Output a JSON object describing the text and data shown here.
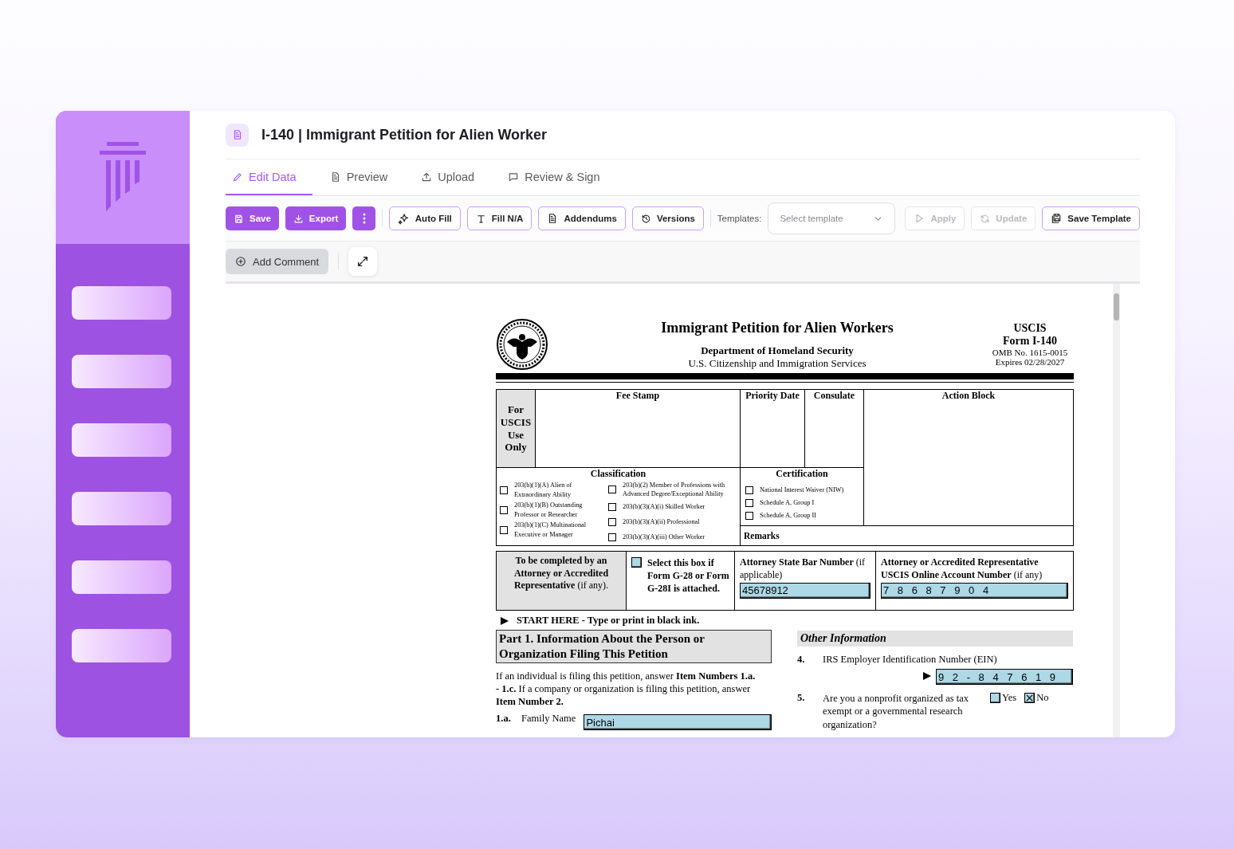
{
  "sidebar": {
    "items": [
      {
        "kind": "placeholder"
      },
      {
        "kind": "placeholder"
      },
      {
        "kind": "placeholder"
      },
      {
        "kind": "placeholder"
      },
      {
        "kind": "placeholder"
      },
      {
        "kind": "placeholder"
      }
    ]
  },
  "header": {
    "title": "I-140 | Immigrant Petition for Alien Worker"
  },
  "tabs": [
    {
      "label": "Edit Data",
      "selected": true
    },
    {
      "label": "Preview",
      "selected": false
    },
    {
      "label": "Upload",
      "selected": false
    },
    {
      "label": "Review & Sign",
      "selected": false
    }
  ],
  "toolbar": {
    "buttons": [
      {
        "kind": "primary",
        "label": "Save"
      },
      {
        "kind": "primary",
        "label": "Export"
      },
      {
        "kind": "menu"
      },
      {
        "kind": "outline",
        "label": "Auto Fill"
      },
      {
        "kind": "outline",
        "label": "Fill N/A"
      },
      {
        "kind": "outline",
        "label": "Addendums"
      },
      {
        "kind": "outline",
        "label": "Versions"
      }
    ],
    "templates_label": "Templates:",
    "template_select": {
      "placeholder": "Select template"
    },
    "template_buttons": [
      {
        "label": "Apply",
        "disabled": true
      },
      {
        "label": "Update",
        "disabled": true
      },
      {
        "label": "Save Template",
        "disabled": false
      }
    ]
  },
  "comment_bar": {
    "add_comment": "Add Comment"
  },
  "form": {
    "title": "Immigrant Petition for Alien Workers",
    "department": "Department of Homeland Security",
    "agency": "U.S. Citizenship and Immigration Services",
    "agency_short": "USCIS",
    "form_number": "Form I-140",
    "omb": "OMB No. 1615-0015",
    "expires": "Expires 02/28/2027",
    "office_block": {
      "use_only": "For USCIS Use Only",
      "fee_stamp": "Fee Stamp",
      "priority_date": "Priority Date",
      "consulate": "Consulate",
      "action_block": "Action Block",
      "remarks": "Remarks",
      "classification": {
        "title": "Classification",
        "columns": [
          {
            "items": [
              {
                "label": "203(b)(1)(A) Alien of Extraordinary Ability",
                "checked": false
              },
              {
                "label": "203(b)(1)(B) Outstanding Professor or Researcher",
                "checked": false
              },
              {
                "label": "203(b)(1)(C) Multinational Executive or Manager",
                "checked": false
              }
            ]
          },
          {
            "items": [
              {
                "label": "203(b)(2) Member of Professions with Advanced Degree/Exceptional Ability",
                "checked": false
              },
              {
                "label": "203(b)(3)(A)(i) Skilled Worker",
                "checked": false
              },
              {
                "label": "203(b)(3)(A)(ii) Professional",
                "checked": false
              },
              {
                "label": "203(b)(3)(A)(iii) Other Worker",
                "checked": false
              }
            ]
          }
        ]
      },
      "certification": {
        "title": "Certification",
        "items": [
          {
            "label": "National Interest Waiver (NIW)",
            "checked": false
          },
          {
            "label": "Schedule A, Group I",
            "checked": false
          },
          {
            "label": "Schedule A, Group II",
            "checked": false
          }
        ]
      }
    },
    "attorney_block": {
      "note": "**To be completed by an Attorney or Accredited Representative** (if any).",
      "g28": {
        "label": "Select this box if Form G-28 or Form G-28I is attached.",
        "checked": false
      },
      "bar_number": {
        "label": "**Attorney State Bar Number** (if applicable)",
        "value": "45678912"
      },
      "account_number": {
        "label": "**Attorney or Accredited Representative USCIS Online Account Number** (if any)",
        "value": "7 8 6 8 7 9 0 4"
      }
    },
    "start_here": "START HERE - Type or print in black ink.",
    "part1": {
      "heading": "Part 1.  Information About the Person or Organization Filing This Petition",
      "instructions": "If an individual is filing this petition, answer **Item Numbers 1.a. - 1.c.**  If a company or organization is filing this petition, answer **Item Number 2.**",
      "fields": [
        {
          "number": "1.a.",
          "label": "Family Name",
          "value": "Pichai"
        }
      ]
    },
    "other_information": {
      "heading": "Other Information",
      "items": [
        {
          "kind": "comb",
          "number": "4.",
          "label": "IRS Employer Identification Number (EIN)",
          "value": "9 2 - 8 4 7 6 1 9"
        },
        {
          "kind": "yes_no",
          "number": "5.",
          "label": "Are you a nonprofit organized as tax exempt or a governmental research organization?",
          "options": [
            {
              "label": "Yes",
              "checked": false
            },
            {
              "label": "No",
              "checked": true
            }
          ]
        }
      ]
    }
  }
}
